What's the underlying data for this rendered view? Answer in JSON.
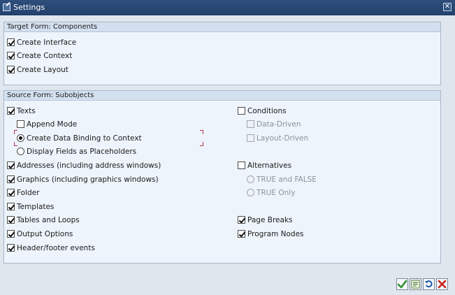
{
  "window": {
    "title": "Settings"
  },
  "target": {
    "title": "Target Form: Components",
    "items": [
      {
        "label": "Create Interface",
        "checked": true
      },
      {
        "label": "Create Context",
        "checked": true
      },
      {
        "label": "Create Layout",
        "checked": true
      }
    ]
  },
  "source": {
    "title": "Source Form: Subobjects",
    "texts": {
      "label": "Texts",
      "checked": true
    },
    "append_mode": {
      "label": "Append Mode",
      "checked": false
    },
    "radio_binding": {
      "label": "Create Data Binding to Context",
      "selected": true
    },
    "radio_placeholders": {
      "label": "Display Fields as Placeholders",
      "selected": false
    },
    "left": [
      {
        "label": "Addresses (including address windows)",
        "checked": true
      },
      {
        "label": "Graphics (including graphics windows)",
        "checked": true
      },
      {
        "label": "Folder",
        "checked": true
      },
      {
        "label": "Templates",
        "checked": true
      },
      {
        "label": "Tables and Loops",
        "checked": true
      },
      {
        "label": "Output Options",
        "checked": true
      },
      {
        "label": "Header/footer events",
        "checked": true
      }
    ],
    "conditions": {
      "label": "Conditions",
      "checked": false
    },
    "data_driven": {
      "label": "Data-Driven",
      "checked": false,
      "disabled": true
    },
    "layout_driven": {
      "label": "Layout-Driven",
      "checked": false,
      "disabled": true
    },
    "alternatives": {
      "label": "Alternatives",
      "checked": false
    },
    "true_false": {
      "label": "TRUE and FALSE",
      "selected": false,
      "disabled": true
    },
    "true_only": {
      "label": "TRUE Only",
      "selected": false,
      "disabled": true
    },
    "page_breaks": {
      "label": "Page Breaks",
      "checked": true
    },
    "program_nodes": {
      "label": "Program Nodes",
      "checked": true
    }
  },
  "buttons": [
    {
      "name": "continue",
      "icon": "checkmark-icon",
      "color": "#2f8f2f"
    },
    {
      "name": "select-all",
      "icon": "select-all-icon",
      "color": "#4a7a2a"
    },
    {
      "name": "reset",
      "icon": "undo-icon",
      "color": "#1e5aa8"
    },
    {
      "name": "cancel",
      "icon": "cancel-icon",
      "color": "#c8281e"
    }
  ]
}
